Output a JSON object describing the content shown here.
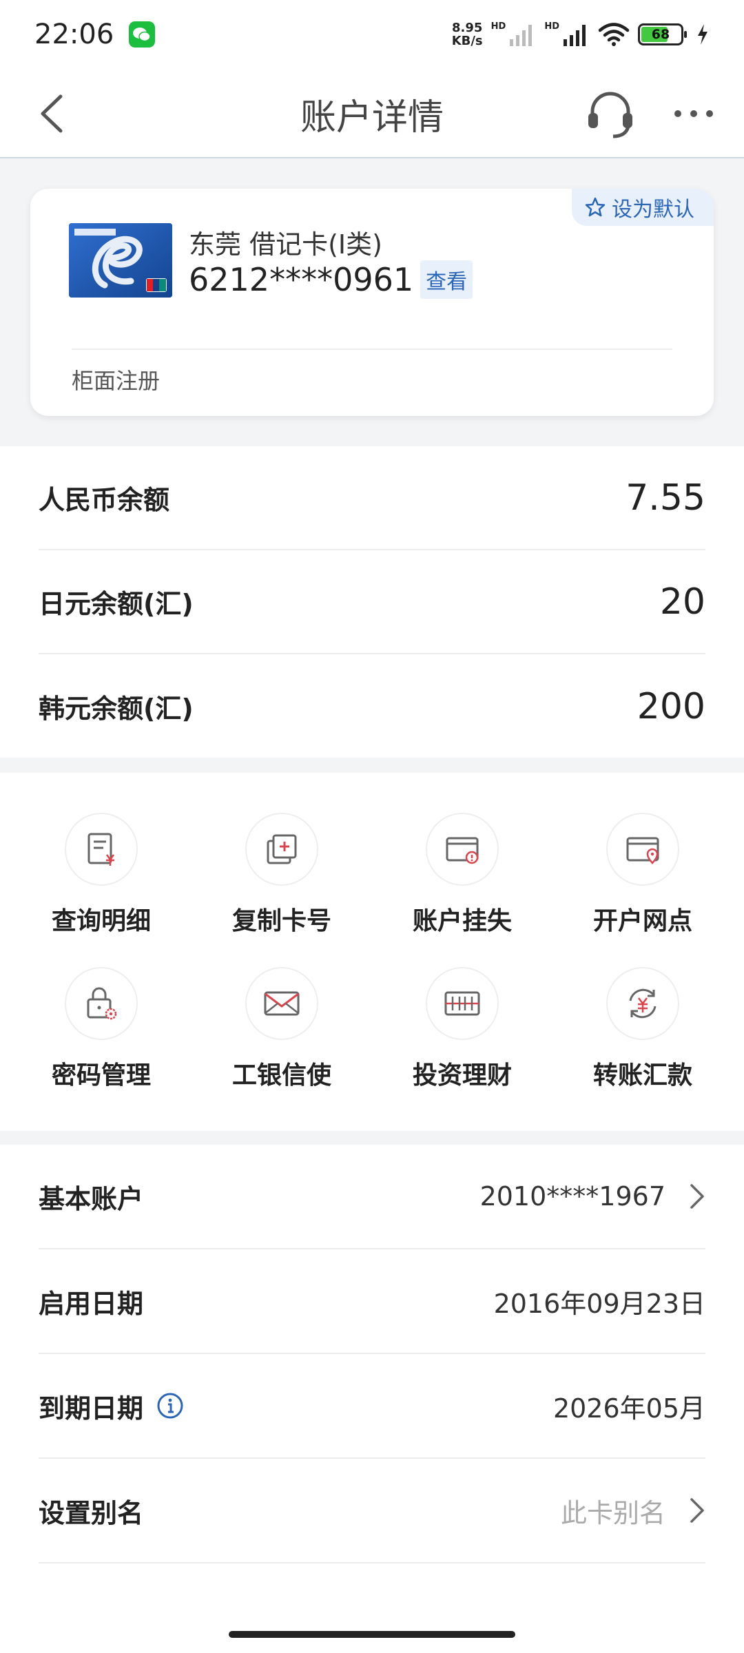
{
  "status_bar": {
    "time": "22:06",
    "net_speed_value": "8.95",
    "net_speed_unit": "KB/s",
    "hd1": "HD",
    "hd2": "HD",
    "battery": "68",
    "icons": [
      "wechat-icon",
      "signal-icon",
      "wifi-icon",
      "battery-icon",
      "charging-icon"
    ]
  },
  "nav": {
    "title": "账户详情",
    "icons": [
      "back-icon",
      "customer-service-icon",
      "more-icon"
    ]
  },
  "card": {
    "set_default": "设为默认",
    "name": "东莞 借记卡(I类)",
    "number": "6212****0961",
    "view": "查看",
    "registration": "柜面注册",
    "logo_icon": "icbc-card-logo"
  },
  "balances": [
    {
      "label": "人民币余额",
      "value": "7.55"
    },
    {
      "label": "日元余额(汇)",
      "value": "20"
    },
    {
      "label": "韩元余额(汇)",
      "value": "200"
    }
  ],
  "actions": [
    {
      "label": "查询明细",
      "icon": "query-detail-icon"
    },
    {
      "label": "复制卡号",
      "icon": "copy-card-icon"
    },
    {
      "label": "账户挂失",
      "icon": "report-loss-icon"
    },
    {
      "label": "开户网点",
      "icon": "branch-location-icon"
    },
    {
      "label": "密码管理",
      "icon": "password-lock-icon"
    },
    {
      "label": "工银信使",
      "icon": "envelope-icon"
    },
    {
      "label": "投资理财",
      "icon": "investment-icon"
    },
    {
      "label": "转账汇款",
      "icon": "transfer-icon"
    }
  ],
  "info": [
    {
      "label": "基本账户",
      "value": "2010****1967"
    },
    {
      "label": "启用日期",
      "value": "2016年09月23日"
    },
    {
      "label": "到期日期",
      "value": "2026年05月"
    },
    {
      "label": "设置别名",
      "value": "此卡别名"
    }
  ],
  "colors": {
    "accent_blue": "#2b65b5",
    "icon_red": "#d9454c",
    "battery_green": "#43c940"
  }
}
